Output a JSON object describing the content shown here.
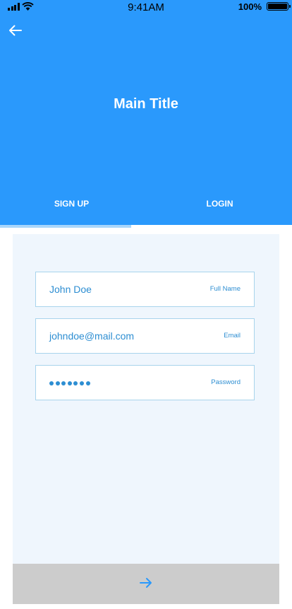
{
  "status_bar": {
    "time": "9:41AM",
    "battery_percent": "100%",
    "icons": [
      "signal-icon",
      "wifi-icon",
      "battery-icon"
    ]
  },
  "header": {
    "back_icon": "arrow-left-icon",
    "title": "Main Title",
    "background_color": "#2a99fc"
  },
  "tabs": [
    {
      "label": "SIGN UP",
      "active": true
    },
    {
      "label": "LOGIN",
      "active": false
    }
  ],
  "form": {
    "fields": [
      {
        "label": "Full Name",
        "value": "John Doe"
      },
      {
        "label": "Email",
        "value": "johndoe@mail.com"
      },
      {
        "label": "Password",
        "value": "•••••••",
        "masked": true
      }
    ],
    "accent_color": "#2d8ed2"
  },
  "submit": {
    "icon": "arrow-right-icon",
    "background_color": "#cccccc"
  }
}
